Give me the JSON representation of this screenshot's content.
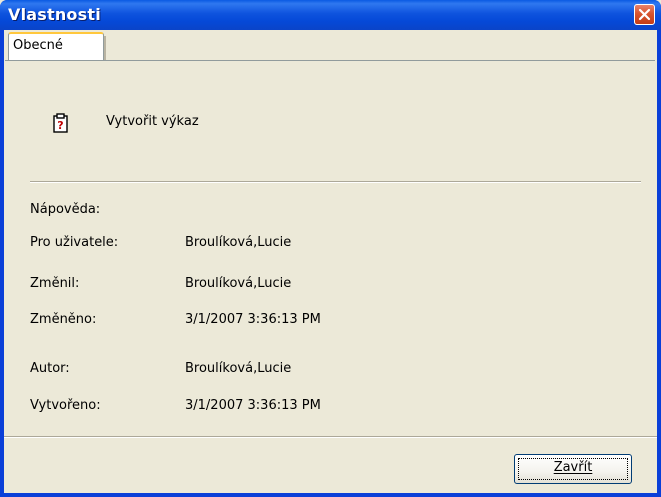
{
  "window": {
    "title": "Vlastnosti"
  },
  "tabs": [
    {
      "label": "Obecné",
      "active": true
    }
  ],
  "report": {
    "icon": "report-question-icon",
    "name": "Vytvořit výkaz"
  },
  "properties": {
    "help_label": "Nápověda:",
    "for_user_label": "Pro uživatele:",
    "for_user_value": "Broulíková,Lucie",
    "modified_by_label": "Změnil:",
    "modified_by_value": "Broulíková,Lucie",
    "modified_label": "Změněno:",
    "modified_value": "3/1/2007 3:36:13 PM",
    "author_label": "Autor:",
    "author_value": "Broulíková,Lucie",
    "created_label": "Vytvořeno:",
    "created_value": "3/1/2007 3:36:13 PM"
  },
  "buttons": {
    "close_label": "Zavřít"
  },
  "colors": {
    "titlebar": "#0a4fdc",
    "close_button": "#d8552f",
    "dialog_bg": "#ece9d8",
    "tab_highlight": "#ffc73c"
  }
}
